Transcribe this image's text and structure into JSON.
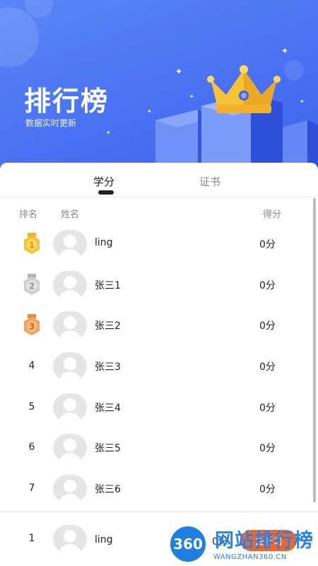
{
  "banner": {
    "title": "排行榜",
    "subtitle": "数据实时更新"
  },
  "tabs": [
    {
      "label": "学分",
      "active": true
    },
    {
      "label": "证书",
      "active": false
    }
  ],
  "columns": {
    "rank": "排名",
    "name": "姓名",
    "score": "得分"
  },
  "ranking": [
    {
      "rank": "1",
      "medal": "gold-medal-icon",
      "name": "ling",
      "score": "0分"
    },
    {
      "rank": "2",
      "medal": "silver-medal-icon",
      "name": "张三1",
      "score": "0分"
    },
    {
      "rank": "3",
      "medal": "bronze-medal-icon",
      "name": "张三2",
      "score": "0分"
    },
    {
      "rank": "4",
      "medal": "",
      "name": "张三3",
      "score": "0分"
    },
    {
      "rank": "5",
      "medal": "",
      "name": "张三4",
      "score": "0分"
    },
    {
      "rank": "6",
      "medal": "",
      "name": "张三5",
      "score": "0分"
    },
    {
      "rank": "7",
      "medal": "",
      "name": "张三6",
      "score": "0分"
    }
  ],
  "my_rank": {
    "rank": "1",
    "name": "ling",
    "score": "0分",
    "button_label": "去学习"
  },
  "watermark": {
    "logo_text": "360",
    "brand": "网站排行榜",
    "url": "WANGZHAN360.CN"
  },
  "colors": {
    "banner": "#4a72f2",
    "gold": "#f5c431",
    "silver": "#c4c4c4",
    "bronze": "#f0a35a",
    "action": "#f0672a"
  }
}
